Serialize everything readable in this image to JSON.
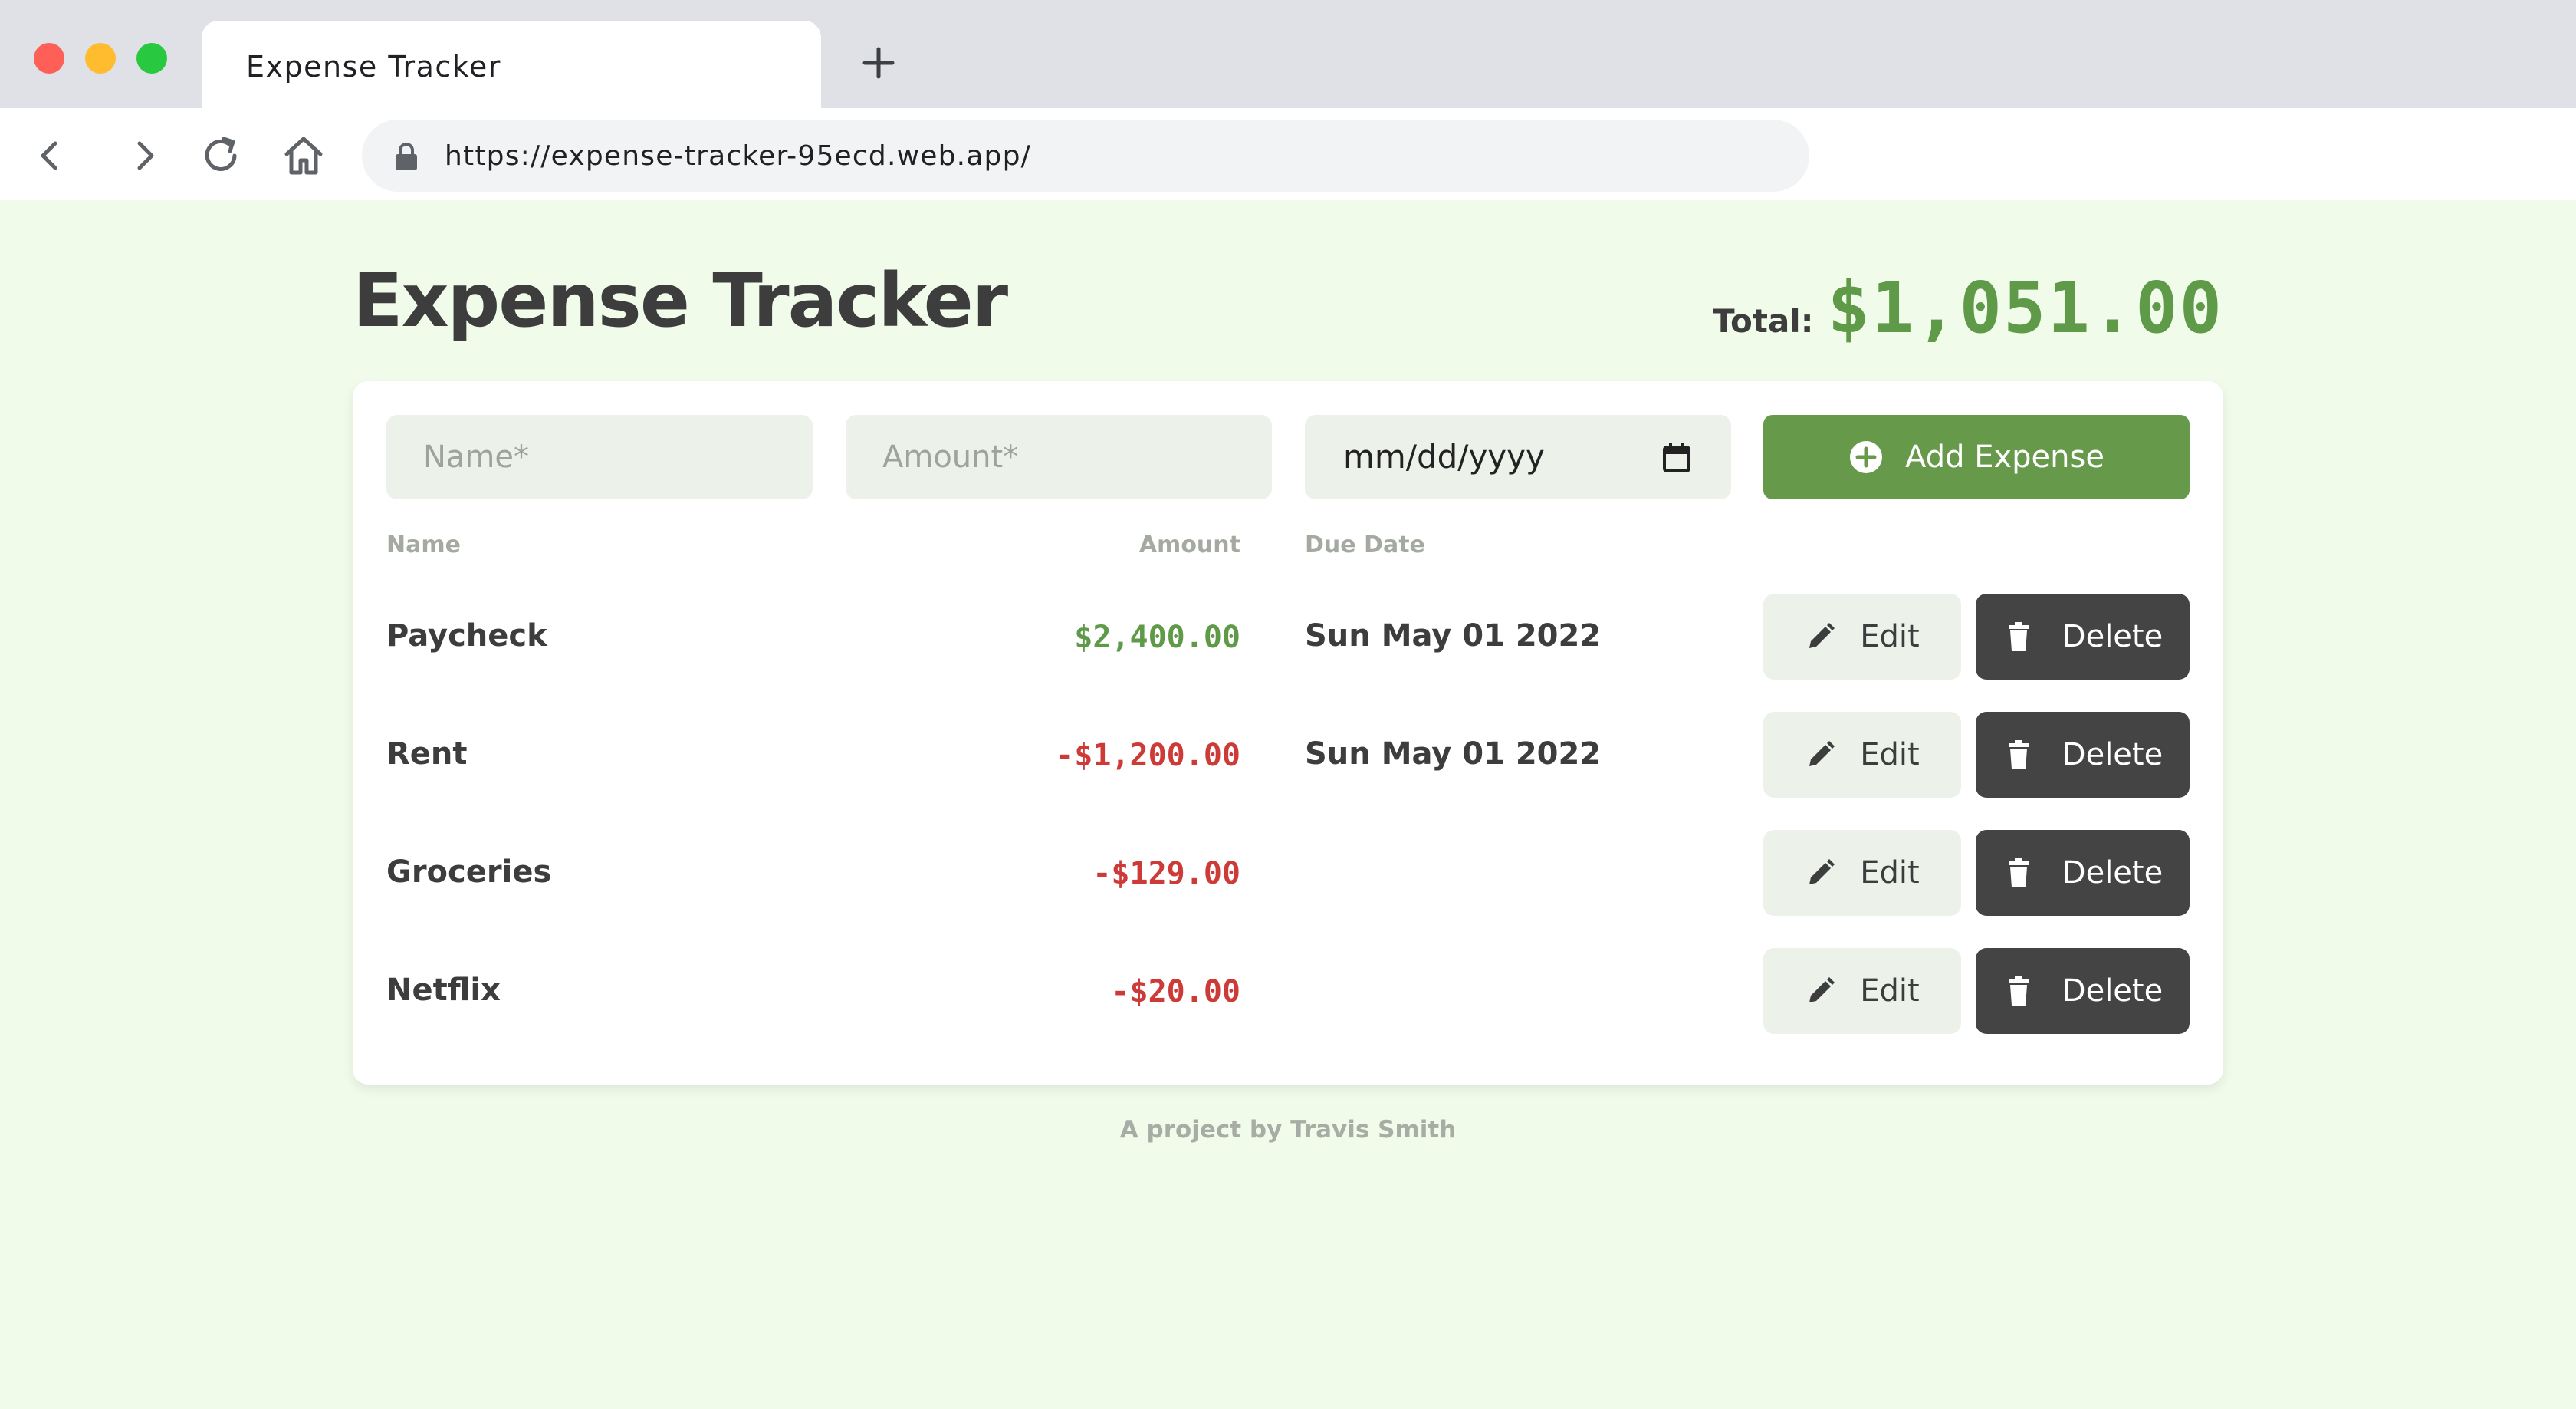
{
  "browser": {
    "tab_title": "Expense Tracker",
    "url": "https://expense-tracker-95ecd.web.app/",
    "icons": [
      "back-icon",
      "forward-icon",
      "reload-icon",
      "home-icon",
      "lock-icon",
      "plus-icon"
    ]
  },
  "header": {
    "title": "Expense Tracker",
    "total_label": "Total:",
    "total_value": "$1,051.00"
  },
  "form": {
    "name_placeholder": "Name*",
    "amount_placeholder": "Amount*",
    "date_placeholder": "mm/dd/yyyy",
    "add_label": "Add Expense"
  },
  "columns": {
    "name": "Name",
    "amount": "Amount",
    "due_date": "Due Date"
  },
  "rows": [
    {
      "name": "Paycheck",
      "amount": "$2,400.00",
      "date": "Sun May 01 2022",
      "type": "positive"
    },
    {
      "name": "Rent",
      "amount": "-$1,200.00",
      "date": "Sun May 01 2022",
      "type": "negative"
    },
    {
      "name": "Groceries",
      "amount": "-$129.00",
      "date": "",
      "type": "negative"
    },
    {
      "name": "Netflix",
      "amount": "-$20.00",
      "date": "",
      "type": "negative"
    }
  ],
  "actions": {
    "edit_label": "Edit",
    "delete_label": "Delete"
  },
  "footer": {
    "text": "A project by Travis Smith"
  },
  "colors": {
    "background": "#f1fbea",
    "accent_green": "#66994a",
    "positive_amount": "#5e9a48",
    "negative_amount": "#cc3b38",
    "delete_button": "#444444"
  }
}
